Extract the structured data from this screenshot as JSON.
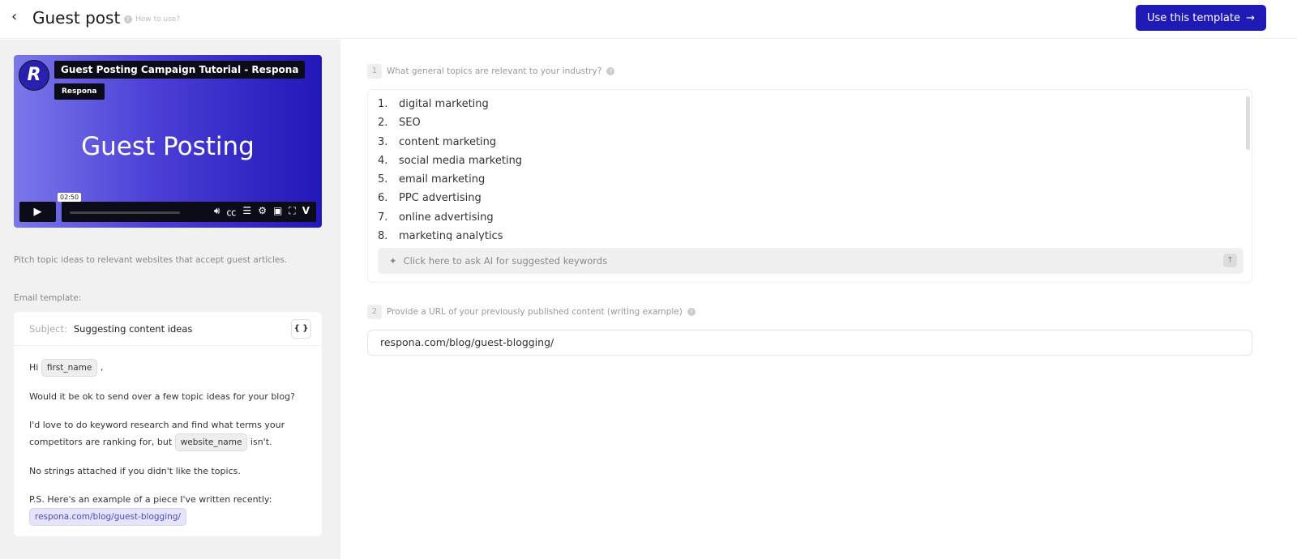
{
  "header": {
    "back_icon": "chevron-left-icon",
    "title": "Guest post",
    "how_to_use": "How to use?",
    "cta": "Use this template",
    "cta_color": "#1f1ab5"
  },
  "video": {
    "logo": "R",
    "title": "Guest Posting Campaign Tutorial - Respona",
    "channel": "Respona",
    "headline": "Guest Posting",
    "time": "02:50"
  },
  "description": "Pitch topic ideas to relevant websites that accept guest articles.",
  "email": {
    "label": "Email template:",
    "subject_label": "Subject:",
    "subject": "Suggesting content ideas",
    "variables_button": "{ }",
    "greeting": "Hi",
    "first_name_var": "first_name",
    "comma": ",",
    "p1": "Would it be ok to send over a few topic ideas for your blog?",
    "p2a": "I'd love to do keyword research and find what terms your competitors are ranking for, but",
    "website_var": "website_name",
    "p2b": "isn't.",
    "p3": "No strings attached if you didn't like the topics.",
    "p4": "P.S. Here's an example of a piece I've written recently:",
    "link": "respona.com/blog/guest-blogging/"
  },
  "questions": [
    {
      "num": "1",
      "label": "What general topics are relevant to your industry?",
      "items": [
        "digital marketing",
        "SEO",
        "content marketing",
        "social media marketing",
        "email marketing",
        "PPC advertising",
        "online advertising",
        "marketing analytics"
      ],
      "ai_prompt": "Click here to ask AI for suggested keywords"
    },
    {
      "num": "2",
      "label": "Provide a URL of your previously published content (writing example)",
      "value": "respona.com/blog/guest-blogging/"
    }
  ]
}
